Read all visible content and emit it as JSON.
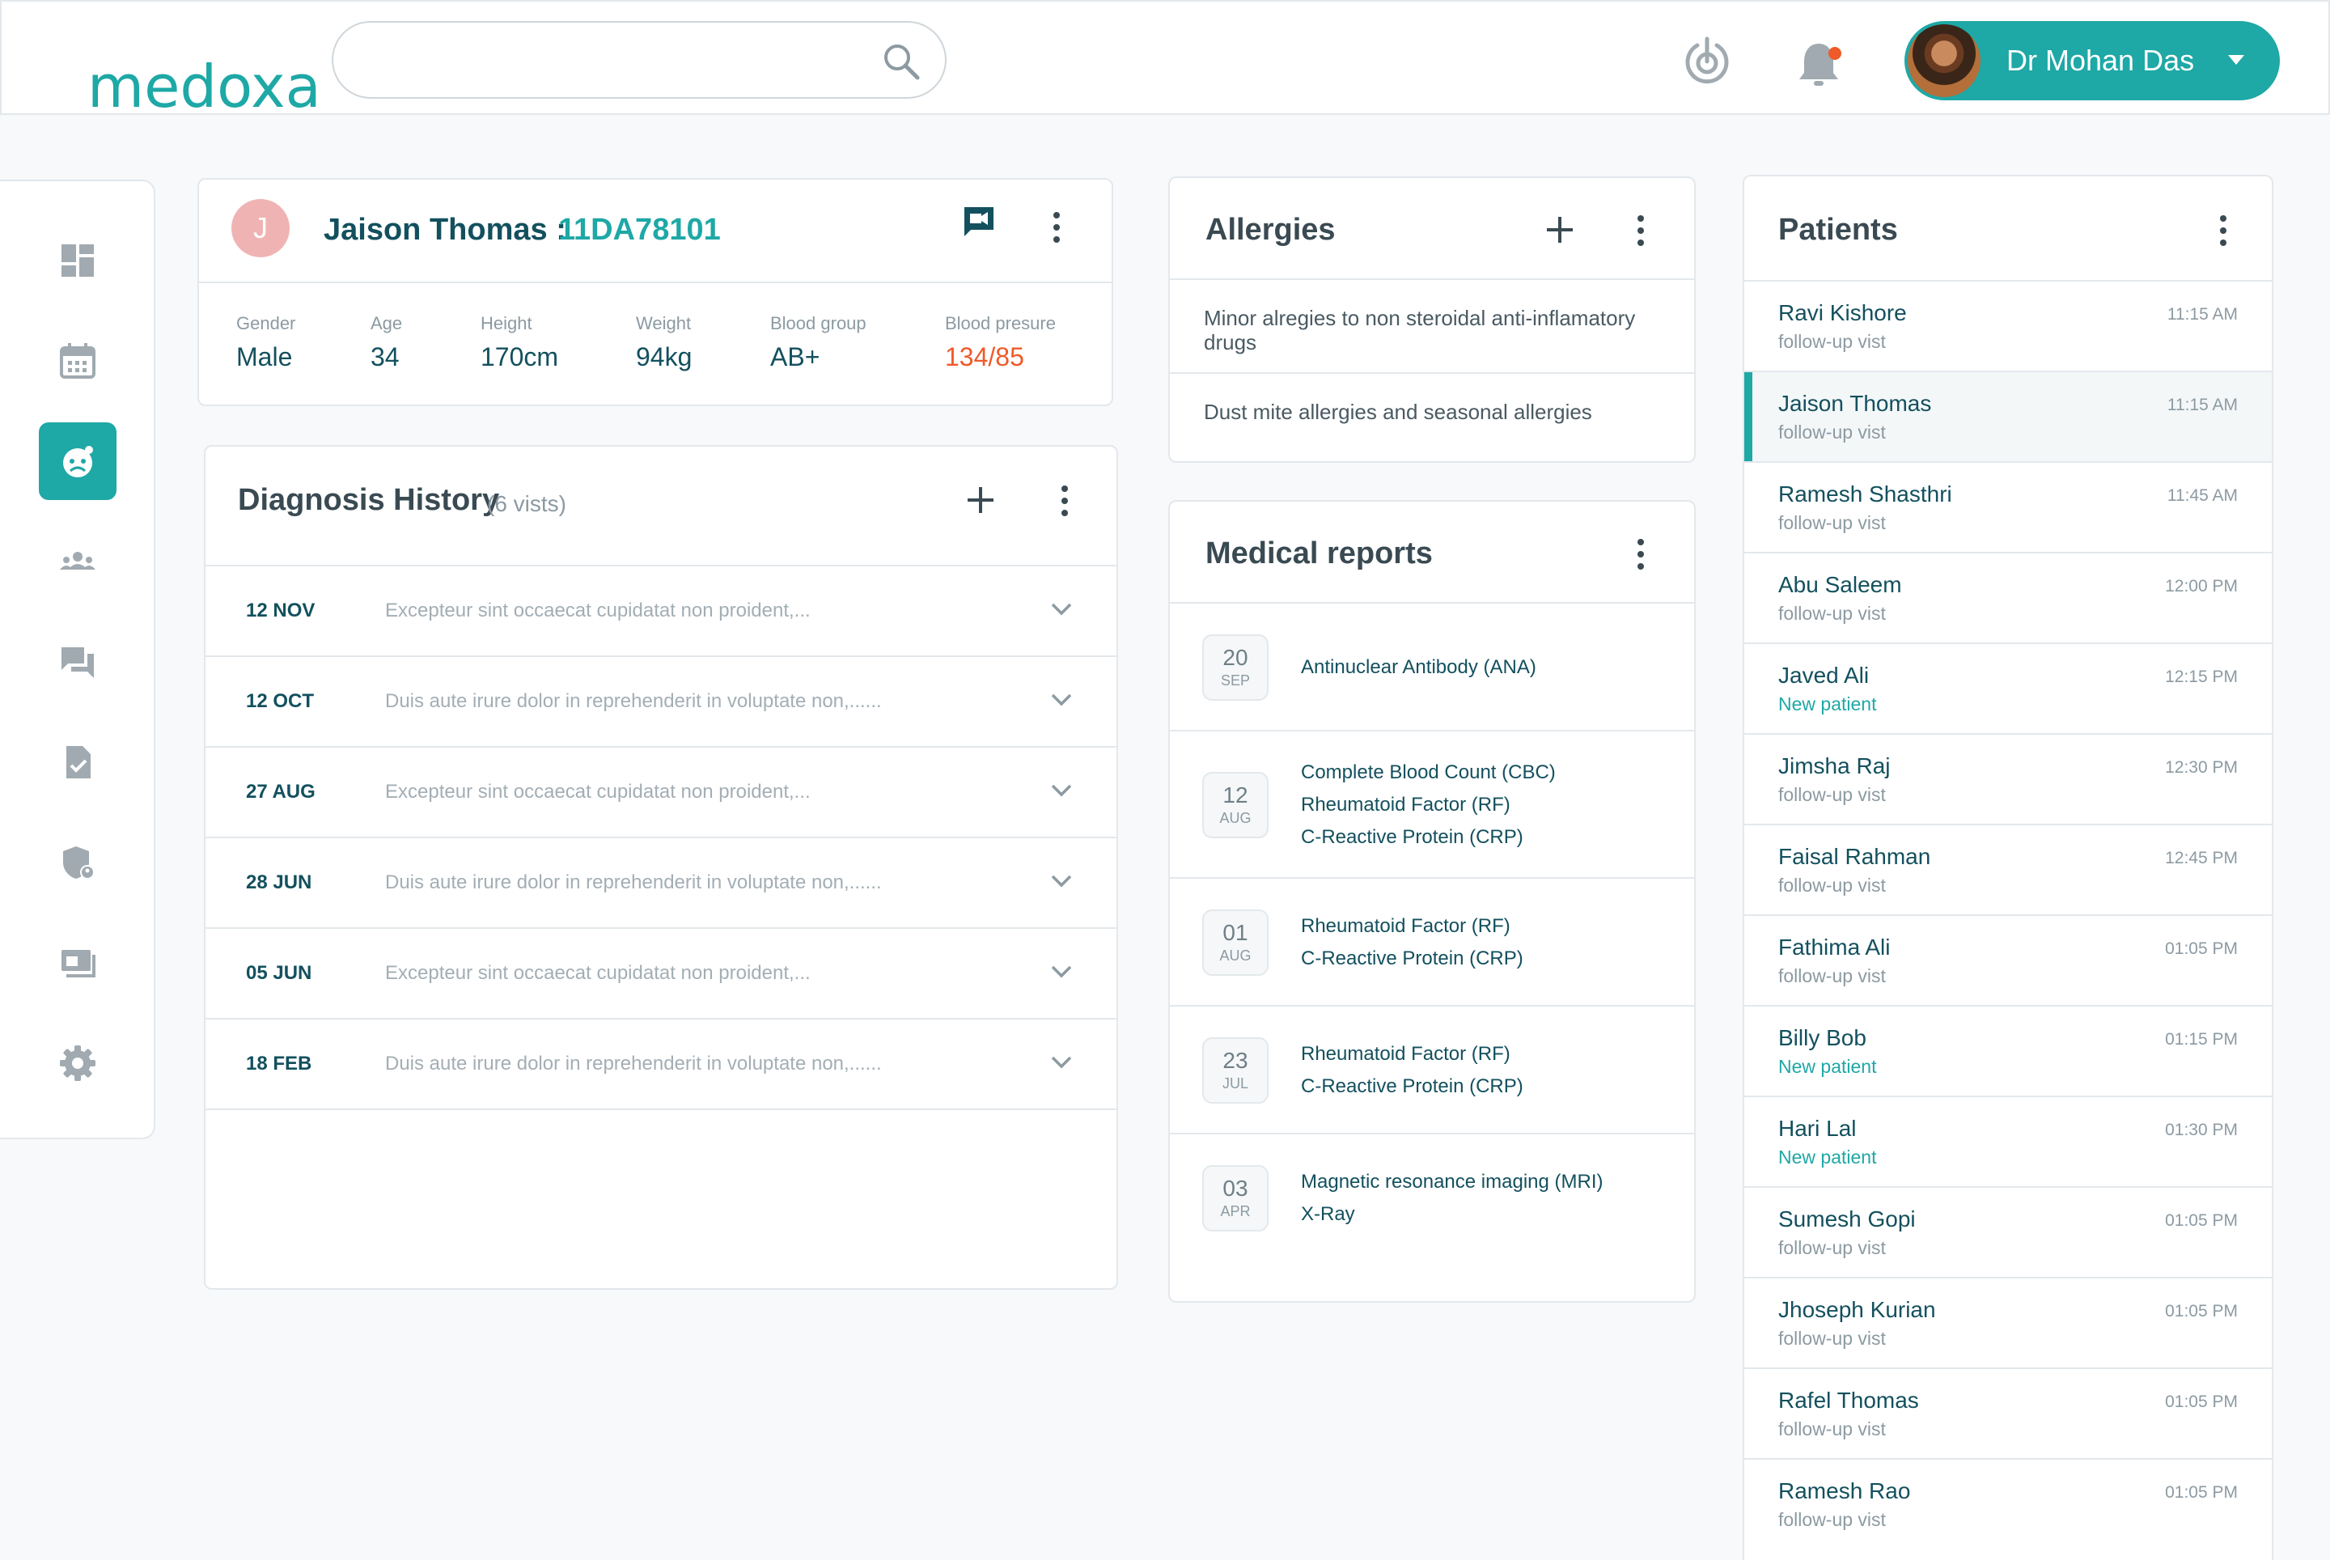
{
  "app": {
    "logo": "medoxa"
  },
  "search": {
    "placeholder": "",
    "value": ""
  },
  "user": {
    "name": "Dr Mohan Das"
  },
  "sidebar": {
    "items": [
      {
        "name": "sidebar-item-dashboard",
        "icon": "dashboard-icon"
      },
      {
        "name": "sidebar-item-calendar",
        "icon": "calendar-icon"
      },
      {
        "name": "sidebar-item-patient",
        "icon": "patient-face-icon",
        "active": true
      },
      {
        "name": "sidebar-item-users",
        "icon": "group-icon"
      },
      {
        "name": "sidebar-item-messages",
        "icon": "chat-icon"
      },
      {
        "name": "sidebar-item-reports",
        "icon": "document-check-icon"
      },
      {
        "name": "sidebar-item-security",
        "icon": "shield-user-icon"
      },
      {
        "name": "sidebar-item-billing",
        "icon": "cash-icon"
      },
      {
        "name": "sidebar-item-settings",
        "icon": "gear-icon"
      }
    ]
  },
  "patient": {
    "initial": "J",
    "name": "Jaison Thomas :",
    "id": "11DA78101",
    "vitals": [
      {
        "label": "Gender",
        "value": "Male"
      },
      {
        "label": "Age",
        "value": "34"
      },
      {
        "label": "Height",
        "value": "170cm"
      },
      {
        "label": "Weight",
        "value": "94kg"
      },
      {
        "label": "Blood group",
        "value": "AB+"
      },
      {
        "label": "Blood presure",
        "value": "134/85"
      }
    ]
  },
  "diagnosis": {
    "title": "Diagnosis History",
    "count": "(6 vists)",
    "rows": [
      {
        "date": "12 NOV",
        "text": "Excepteur sint occaecat cupidatat non proident,..."
      },
      {
        "date": "12 OCT",
        "text": "Duis aute irure dolor in reprehenderit in voluptate  non,......"
      },
      {
        "date": "27 AUG",
        "text": "Excepteur sint occaecat cupidatat non proident,..."
      },
      {
        "date": "28 JUN",
        "text": "Duis aute irure dolor in reprehenderit in voluptate  non,......"
      },
      {
        "date": "05 JUN",
        "text": "Excepteur sint occaecat cupidatat non proident,..."
      },
      {
        "date": "18 FEB",
        "text": "Duis aute irure dolor in reprehenderit in voluptate  non,......"
      }
    ]
  },
  "allergies": {
    "title": "Allergies",
    "items": [
      "Minor alregies to non steroidal anti-inflamatory drugs",
      "Dust mite allergies and seasonal allergies"
    ]
  },
  "reports": {
    "title": "Medical reports",
    "rows": [
      {
        "day": "20",
        "month": "SEP",
        "items": [
          "Antinuclear Antibody (ANA)"
        ]
      },
      {
        "day": "12",
        "month": "AUG",
        "items": [
          "Complete Blood Count (CBC)",
          "Rheumatoid Factor (RF)",
          "C-Reactive Protein (CRP)"
        ]
      },
      {
        "day": "01",
        "month": "AUG",
        "items": [
          "Rheumatoid Factor (RF)",
          "C-Reactive Protein (CRP)"
        ]
      },
      {
        "day": "23",
        "month": "JUL",
        "items": [
          "Rheumatoid Factor (RF)",
          "C-Reactive Protein (CRP)"
        ]
      },
      {
        "day": "03",
        "month": "APR",
        "items": [
          "Magnetic resonance imaging (MRI)",
          "X-Ray"
        ]
      }
    ]
  },
  "patients": {
    "title": "Patients",
    "rows": [
      {
        "name": "Ravi Kishore",
        "status": "follow-up vist",
        "time": "11:15 AM"
      },
      {
        "name": "Jaison Thomas",
        "status": "follow-up vist",
        "time": "11:15 AM",
        "active": true
      },
      {
        "name": "Ramesh Shasthri",
        "status": "follow-up vist",
        "time": "11:45 AM"
      },
      {
        "name": "Abu Saleem",
        "status": "follow-up vist",
        "time": "12:00 PM"
      },
      {
        "name": "Javed Ali",
        "status": "New patient",
        "time": "12:15 PM",
        "new": true
      },
      {
        "name": "Jimsha Raj",
        "status": "follow-up vist",
        "time": "12:30 PM"
      },
      {
        "name": "Faisal Rahman",
        "status": "follow-up vist",
        "time": "12:45 PM"
      },
      {
        "name": "Fathima Ali",
        "status": "follow-up vist",
        "time": "01:05 PM"
      },
      {
        "name": "Billy Bob",
        "status": "New patient",
        "time": "01:15 PM",
        "new": true
      },
      {
        "name": "Hari Lal",
        "status": "New patient",
        "time": "01:30 PM",
        "new": true
      },
      {
        "name": "Sumesh Gopi",
        "status": "follow-up vist",
        "time": "01:05 PM"
      },
      {
        "name": "Jhoseph Kurian",
        "status": "follow-up vist",
        "time": "01:05 PM"
      },
      {
        "name": "Rafel Thomas",
        "status": "follow-up vist",
        "time": "01:05 PM"
      },
      {
        "name": "Ramesh Rao",
        "status": "follow-up vist",
        "time": "01:05 PM"
      }
    ]
  },
  "colors": {
    "accent": "#1ea8a6",
    "primary_text": "#13505e",
    "alert": "#ef5a2a",
    "muted": "#8c9aa2"
  }
}
